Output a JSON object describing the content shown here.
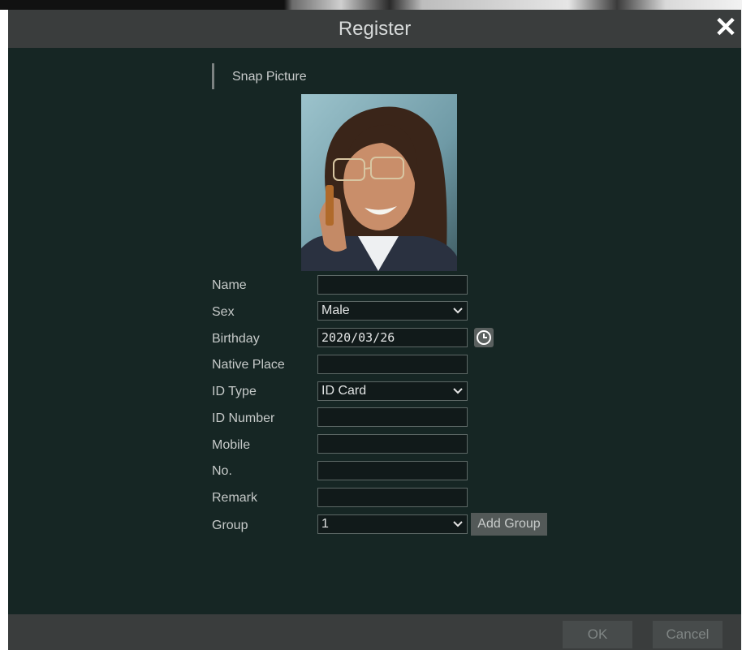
{
  "dialog": {
    "title": "Register",
    "close_icon": "close-icon"
  },
  "snap": {
    "section_title": "Snap Picture",
    "photo_desc_icon": "portrait-photo"
  },
  "form": {
    "name": {
      "label": "Name",
      "value": ""
    },
    "sex": {
      "label": "Sex",
      "value": "Male"
    },
    "birthday": {
      "label": "Birthday",
      "value": "2020/03/26"
    },
    "native_place": {
      "label": "Native Place",
      "value": ""
    },
    "id_type": {
      "label": "ID Type",
      "value": "ID Card"
    },
    "id_number": {
      "label": "ID Number",
      "value": ""
    },
    "mobile": {
      "label": "Mobile",
      "value": ""
    },
    "no": {
      "label": "No.",
      "value": ""
    },
    "remark": {
      "label": "Remark",
      "value": ""
    },
    "group": {
      "label": "Group",
      "value": "1"
    },
    "add_group_label": "Add Group"
  },
  "footer": {
    "ok_label": "OK",
    "cancel_label": "Cancel"
  },
  "colors": {
    "dialog_bg": "#162624",
    "bar_bg": "#3a3d3d",
    "field_bg": "#111a1a"
  }
}
